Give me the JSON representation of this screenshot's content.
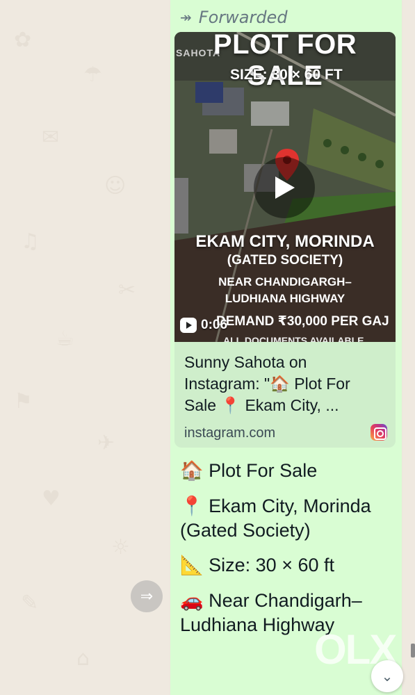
{
  "message": {
    "forwarded_label": "Forwarded",
    "video": {
      "overlay_title": "PLOT FOR SALE",
      "overlay_size": "SIZE:  30 × 60 FT",
      "overlay_logo": "SAHOTA",
      "overlay_location": "EKAM CITY, MORINDA",
      "overlay_gated": "(GATED SOCIETY)",
      "overlay_near_1": "NEAR CHANDIGARGH–",
      "overlay_near_2": "LUDHIANA HIGHWAY",
      "overlay_demand": "DEMAND ₹30,000 PER GAJ",
      "overlay_docs": "ALL DOCUMENTS AVAILABLE",
      "duration": "0:06"
    },
    "link_preview": {
      "title": "Sunny Sahota on Instagram: \"🏠 Plot For Sale 📍 Ekam City, ...",
      "domain": "instagram.com",
      "icon": "instagram-icon"
    },
    "body_lines": [
      {
        "emoji": "🏠",
        "text": "Plot For Sale"
      },
      {
        "emoji": "📍",
        "text": "Ekam City, Morinda (Gated Society)"
      },
      {
        "emoji": "📐",
        "text": "Size: 30 × 60 ft"
      },
      {
        "emoji": "🚗",
        "text": "Near Chandigarh–Ludhiana Highway"
      }
    ]
  },
  "watermark": "OLX",
  "colors": {
    "bubble": "#d9fdd3",
    "link_card": "#cfeecb",
    "wallpaper": "#efe9e0",
    "meta_text": "#667781"
  }
}
